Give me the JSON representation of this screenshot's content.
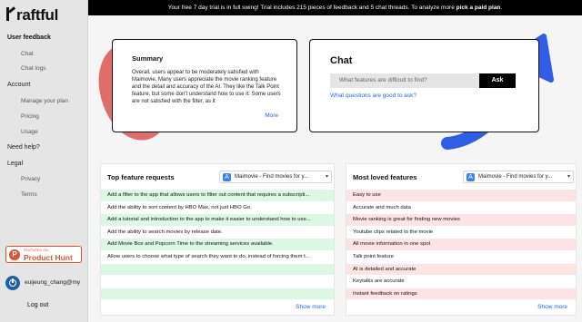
{
  "sidebar": {
    "logo": "raftful",
    "sections": [
      {
        "label": "User feedback",
        "items": [
          "Chat",
          "Chat logs"
        ]
      },
      {
        "label": "Account",
        "items": [
          "Manage your plan",
          "Pricing",
          "Usage"
        ]
      },
      {
        "label": "Need help?",
        "items": []
      },
      {
        "label": "Legal",
        "items": [
          "Privacy",
          "Terms"
        ]
      }
    ],
    "product_hunt_small": "FEATURED ON",
    "product_hunt_big": "Product Hunt",
    "user_name": "euijeung_chang@my",
    "logout": "Log out"
  },
  "banner": {
    "text": "Your free 7 day trial is in full swing! Trial includes 215 pieces of feedback and 5 chat threads. To analyze more ",
    "link": "pick a paid plan",
    "end": "."
  },
  "summary": {
    "title": "Summary",
    "body": "Overall, users appear to be moderately satisfied with Maimovie. Many users appreciate the movie ranking feature and the detail and accuracy of the AI. They like the Talk Point feature, but some don't understand how to use it. Some users are not satisfied with the filter, as it",
    "more": "More"
  },
  "chat": {
    "title": "Chat",
    "placeholder": "What features are difficult to find?",
    "ask": "Ask",
    "suggestion": "What questions are good to ask?"
  },
  "requests": {
    "title": "Top feature requests",
    "app": "Maimovie - Find movies for y...",
    "rows": [
      "Add a filter to the app that allows users to filter out content that requires a subscripti...",
      "Add the ability to sort content by HBO Max, not just HBO Go.",
      "Add a tutorial and introduction to the app to make it easier to understand how to use...",
      "Add the ability to search movies by release date.",
      "Add Movie Box and Popcorn Time to the streaming services available.",
      "Allow users to choose what type of search they want to do, instead of forcing them t...",
      "",
      "",
      ""
    ],
    "show_more": "Show more"
  },
  "loved": {
    "title": "Most loved features",
    "app": "Maimovie - Find movies for y...",
    "rows": [
      "Easy to use",
      "Accurate and much data",
      "Movie ranking is great for finding new movies",
      "Youtube clips related to the movie",
      "All movie information in one spot",
      "Talk point feature",
      "AI is detailed and accurate",
      "Keytalks are accurate",
      "Instant feedback on ratings"
    ],
    "show_more": "Show more"
  },
  "colors": {
    "accent_blue": "#2563eb",
    "arrow_blue": "#2f5de8",
    "blob_red": "#e06c6c",
    "request_row": "#dcf7e3",
    "loved_row": "#fde4e4"
  }
}
